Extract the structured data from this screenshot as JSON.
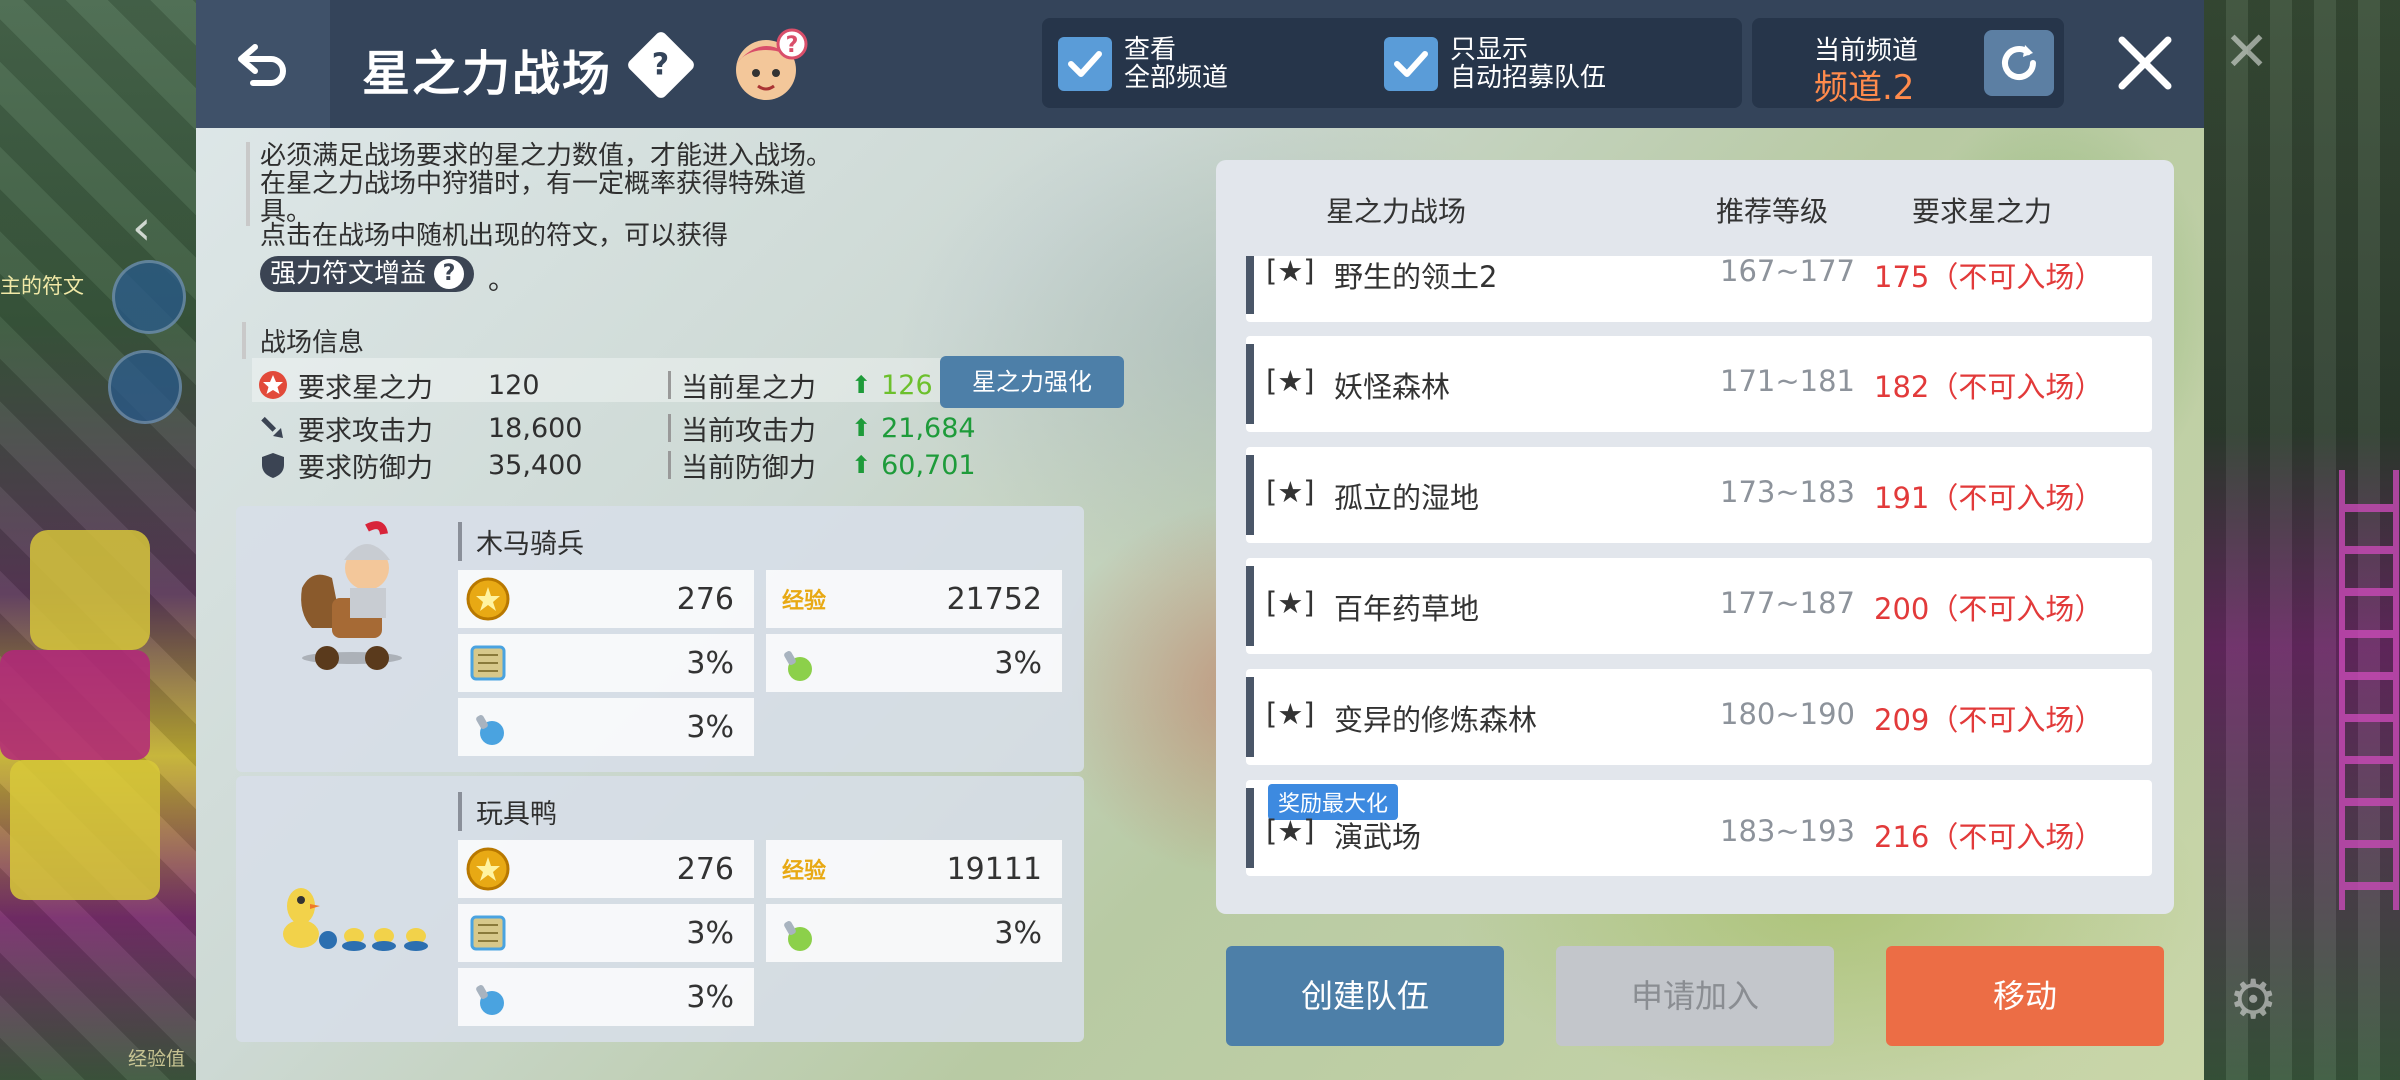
{
  "header": {
    "title": "星之力战场",
    "help_symbol": "?",
    "checkbox_all_channels": "查看\n全部频道",
    "checkbox_auto_recruit": "只显示\n自动招募队伍",
    "channel_label": "当前频道",
    "channel_value": "频道.2"
  },
  "background": {
    "left_text": "主的符文",
    "left_bottom_text": "经验值"
  },
  "description": {
    "line1": "必须满足战场要求的星之力数值，才能进入战场。",
    "line2": "在星之力战场中狩猎时，有一定概率获得特殊道具。",
    "line3": "点击在战场中随机出现的符文，可以获得",
    "rune_pill": "强力符文增益",
    "rune_suffix": "。"
  },
  "battle_info": {
    "title": "战场信息",
    "rows": [
      {
        "label": "要求星之力",
        "value": "120",
        "cur_label": "当前星之力",
        "cur_value": "126"
      },
      {
        "label": "要求攻击力",
        "value": "18,600",
        "cur_label": "当前攻击力",
        "cur_value": "21,684"
      },
      {
        "label": "要求防御力",
        "value": "35,400",
        "cur_label": "当前防御力",
        "cur_value": "60,701"
      }
    ],
    "enhance_button": "星之力强化"
  },
  "monsters": [
    {
      "name": "木马骑兵",
      "meso": "276",
      "exp_label": "经验",
      "exp": "21752",
      "drop1": "3%",
      "drop2": "3%",
      "drop3": "3%"
    },
    {
      "name": "玩具鸭",
      "meso": "276",
      "exp_label": "经验",
      "exp": "19111",
      "drop1": "3%",
      "drop2": "3%",
      "drop3": "3%"
    }
  ],
  "list": {
    "col_name": "星之力战场",
    "col_level": "推荐等级",
    "col_req": "要求星之力",
    "rows": [
      {
        "star": "[★]",
        "name": "野生的领土2",
        "level": "167~177",
        "req": "175（不可入场）"
      },
      {
        "star": "[★]",
        "name": "妖怪森林",
        "level": "171~181",
        "req": "182（不可入场）"
      },
      {
        "star": "[★]",
        "name": "孤立的湿地",
        "level": "173~183",
        "req": "191（不可入场）"
      },
      {
        "star": "[★]",
        "name": "百年药草地",
        "level": "177~187",
        "req": "200（不可入场）"
      },
      {
        "star": "[★]",
        "name": "变异的修炼森林",
        "level": "180~190",
        "req": "209（不可入场）"
      },
      {
        "star": "[★]",
        "name": "演武场",
        "level": "183~193",
        "req": "216（不可入场）",
        "badge": "奖励最大化"
      }
    ]
  },
  "buttons": {
    "create": "创建队伍",
    "apply": "申请加入",
    "move": "移动"
  },
  "colors": {
    "header_bg": "#34445a",
    "accent_blue": "#4d7fa8",
    "move_orange": "#ec6d45",
    "red_text": "#e23a3a",
    "green_text": "#1e9b3a",
    "channel_orange": "#ff8b4c"
  }
}
